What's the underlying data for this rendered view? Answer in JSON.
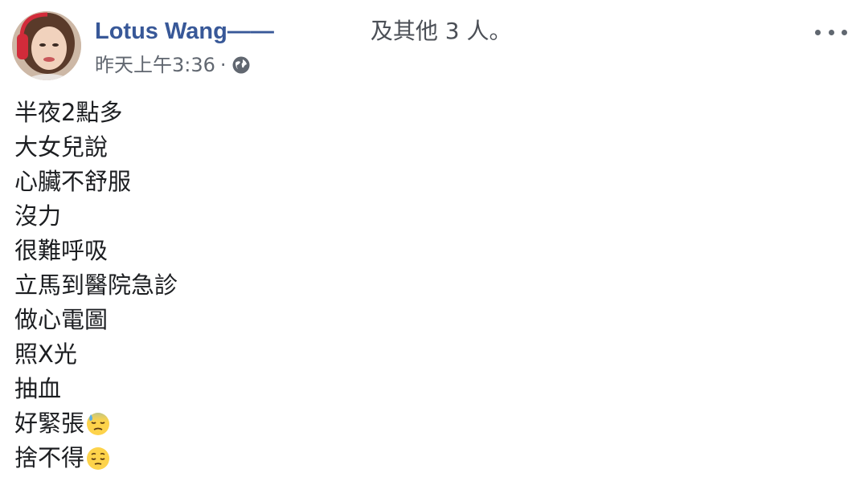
{
  "post": {
    "author": "Lotus Wang",
    "dash": "——",
    "with_text": "及其他 3 人。",
    "timestamp": "昨天上午3:36",
    "separator": "·",
    "privacy_icon": "globe-icon",
    "more_icon": "more-options-icon",
    "body_lines": [
      {
        "text": "半夜2點多",
        "emoji": null
      },
      {
        "text": "大女兒說",
        "emoji": null
      },
      {
        "text": "心臟不舒服",
        "emoji": null
      },
      {
        "text": "沒力",
        "emoji": null
      },
      {
        "text": "很難呼吸",
        "emoji": null
      },
      {
        "text": "立馬到醫院急診",
        "emoji": null
      },
      {
        "text": "做心電圖",
        "emoji": null
      },
      {
        "text": "照X光",
        "emoji": null
      },
      {
        "text": "抽血",
        "emoji": null
      },
      {
        "text": "好緊張",
        "emoji": "downcast-face-with-sweat-emoji"
      },
      {
        "text": "捨不得",
        "emoji": "relieved-face-emoji"
      }
    ]
  },
  "colors": {
    "author": "#385898",
    "meta": "#616770",
    "text": "#1c1e21"
  }
}
